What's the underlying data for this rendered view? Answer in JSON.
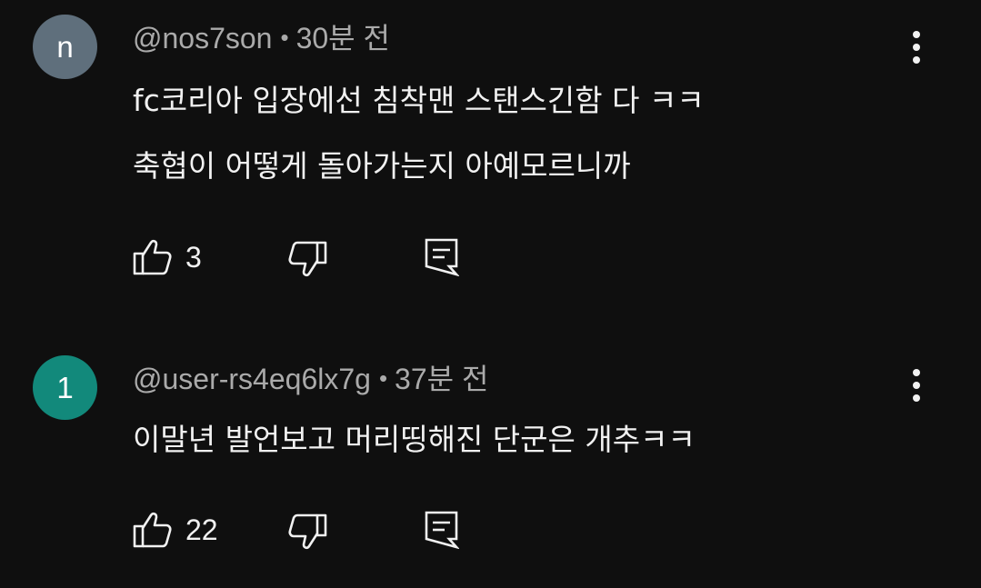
{
  "comments": [
    {
      "avatar_letter": "n",
      "avatar_color": "#5f6f7c",
      "author": "@nos7son",
      "separator": "•",
      "time": "30분 전",
      "lines": [
        "fc코리아 입장에선 침착맨 스탠스긴함 다 ㅋㅋ",
        "축협이 어떻게 돌아가는지 아예모르니까"
      ],
      "likes": "3"
    },
    {
      "avatar_letter": "1",
      "avatar_color": "#12897b",
      "author": "@user-rs4eq6lx7g",
      "separator": "•",
      "time": "37분 전",
      "lines": [
        "이말년 발언보고 머리띵해진 단군은 개추ㅋㅋ"
      ],
      "likes": "22"
    }
  ],
  "icons": {
    "like": "thumbs-up-icon",
    "dislike": "thumbs-down-icon",
    "reply": "reply-comment-icon",
    "more": "more-vertical-icon"
  }
}
